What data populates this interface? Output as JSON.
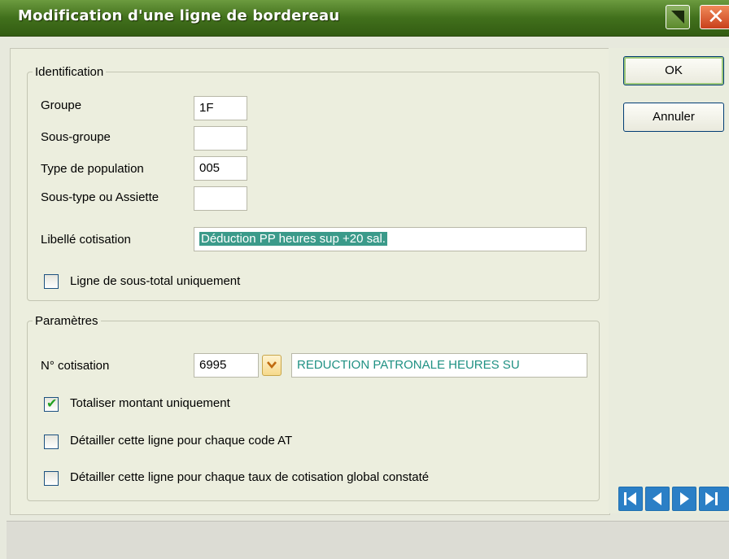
{
  "window": {
    "title": "Modification d'une ligne de bordereau",
    "menu_icon": "window-menu-icon",
    "close_icon": "close-icon"
  },
  "identification": {
    "legend": "Identification",
    "groupe_label": "Groupe",
    "groupe_value": "1F",
    "sous_groupe_label": "Sous-groupe",
    "sous_groupe_value": "",
    "type_population_label": "Type de population",
    "type_population_value": "005",
    "sous_type_label": "Sous-type ou Assiette",
    "sous_type_value": "",
    "libelle_label": "Libellé cotisation",
    "libelle_value": "Déduction PP heures sup +20 sal.",
    "sous_total_label": "Ligne de sous-total uniquement",
    "sous_total_checked": false
  },
  "parametres": {
    "legend": "Paramètres",
    "cotisation_label": "N° cotisation",
    "cotisation_value": "6995",
    "cotisation_desc": "REDUCTION PATRONALE HEURES SU",
    "totaliser_label": "Totaliser montant uniquement",
    "totaliser_checked": true,
    "detailler_at_label": "Détailler cette ligne pour chaque code AT",
    "detailler_at_checked": false,
    "detailler_taux_label": "Détailler cette ligne pour chaque taux de cotisation global constaté",
    "detailler_taux_checked": false
  },
  "buttons": {
    "ok": "OK",
    "annuler": "Annuler"
  },
  "navigation": [
    "first-record-icon",
    "previous-record-icon",
    "next-record-icon",
    "last-record-icon"
  ],
  "colors": {
    "titlebar": "#41701c",
    "selection": "#3b9a8a",
    "teal_text": "#1f9183",
    "nav_button": "#2b7fc6",
    "check_mark": "#21a121"
  }
}
